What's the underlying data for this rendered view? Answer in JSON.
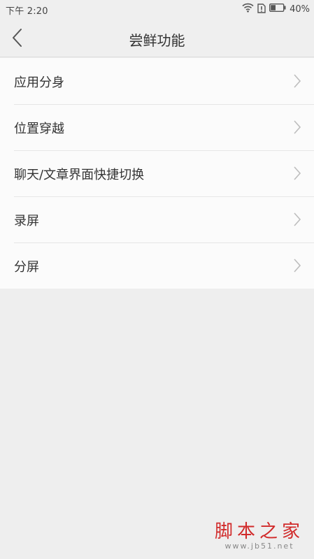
{
  "status_bar": {
    "time": "下午 2:20",
    "battery_percent": "40%",
    "icons": [
      "wifi-icon",
      "sim-alert-icon",
      "battery-icon"
    ],
    "battery_level": 0.4
  },
  "header": {
    "title": "尝鲜功能",
    "back_icon": "chevron-left-icon"
  },
  "list": {
    "items": [
      {
        "label": "应用分身"
      },
      {
        "label": "位置穿越"
      },
      {
        "label": "聊天/文章界面快捷切换"
      },
      {
        "label": "录屏"
      },
      {
        "label": "分屏"
      }
    ],
    "chevron_icon": "chevron-right-icon"
  },
  "watermark": {
    "main": "脚本之家",
    "sub": "www.jb51.net"
  },
  "colors": {
    "background": "#eeeeee",
    "list_background": "#fbfbfb",
    "watermark_red": "#d12a2a"
  }
}
